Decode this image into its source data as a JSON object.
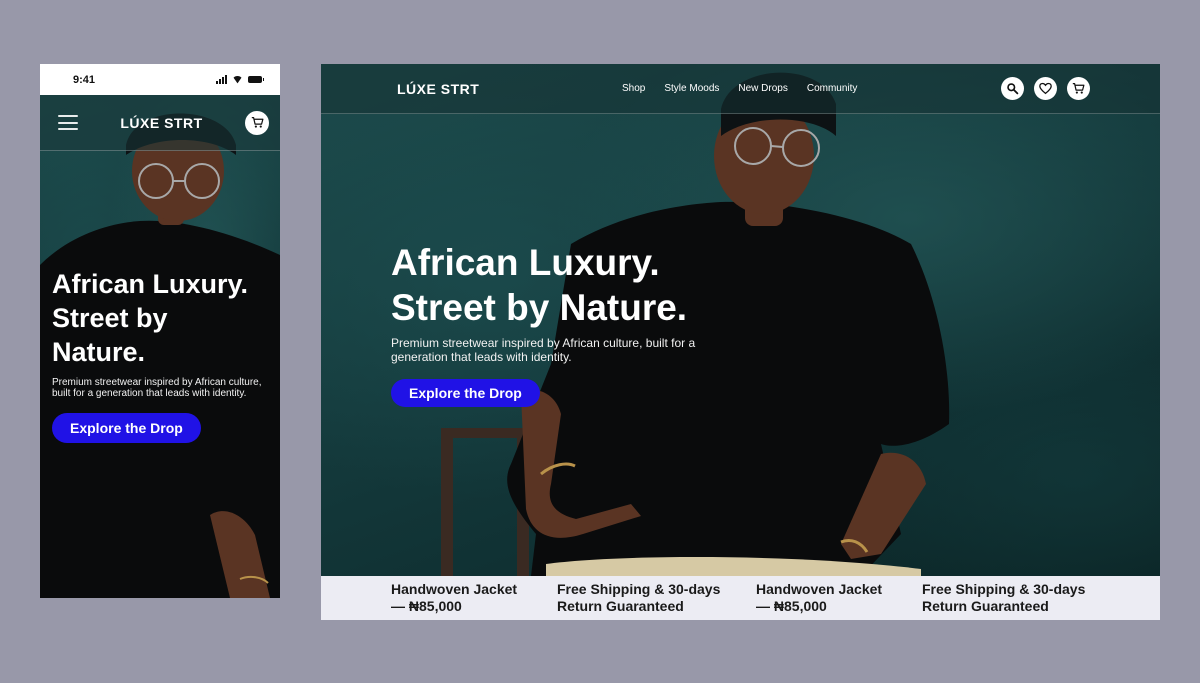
{
  "mobile": {
    "status": {
      "time": "9:41"
    },
    "header": {
      "logo": "LÚXE STRT"
    },
    "hero": {
      "headline": "African Luxury.\n Street by\nNature.",
      "subtitle": "Premium streetwear inspired by African culture, built for a generation that leads with identity.",
      "cta": "Explore the Drop"
    }
  },
  "desktop": {
    "nav": {
      "logo": "LÚXE STRT",
      "links": [
        "Shop",
        "Style Moods",
        "New Drops",
        "Community"
      ]
    },
    "hero": {
      "headline": "African Luxury.\n Street by Nature.",
      "subtitle": "Premium streetwear inspired by African culture, built for a generation that leads with identity.",
      "cta": "Explore the Drop"
    },
    "ticker": [
      "Handwoven Jacket\n— ₦85,000",
      "Free Shipping & 30-days\nReturn Guaranteed",
      "Handwoven Jacket\n— ₦85,000",
      "Free Shipping & 30-days\nReturn Guaranteed"
    ]
  },
  "icons": {
    "menu": "hamburger-icon",
    "cart": "cart-icon",
    "search": "search-icon",
    "wishlist": "heart-icon"
  },
  "colors": {
    "page_background": "#9898a9",
    "hero_teal": "#153c3e",
    "cta_blue": "#2012e6",
    "ticker_background": "#ececf3",
    "text_white": "#ffffff"
  }
}
